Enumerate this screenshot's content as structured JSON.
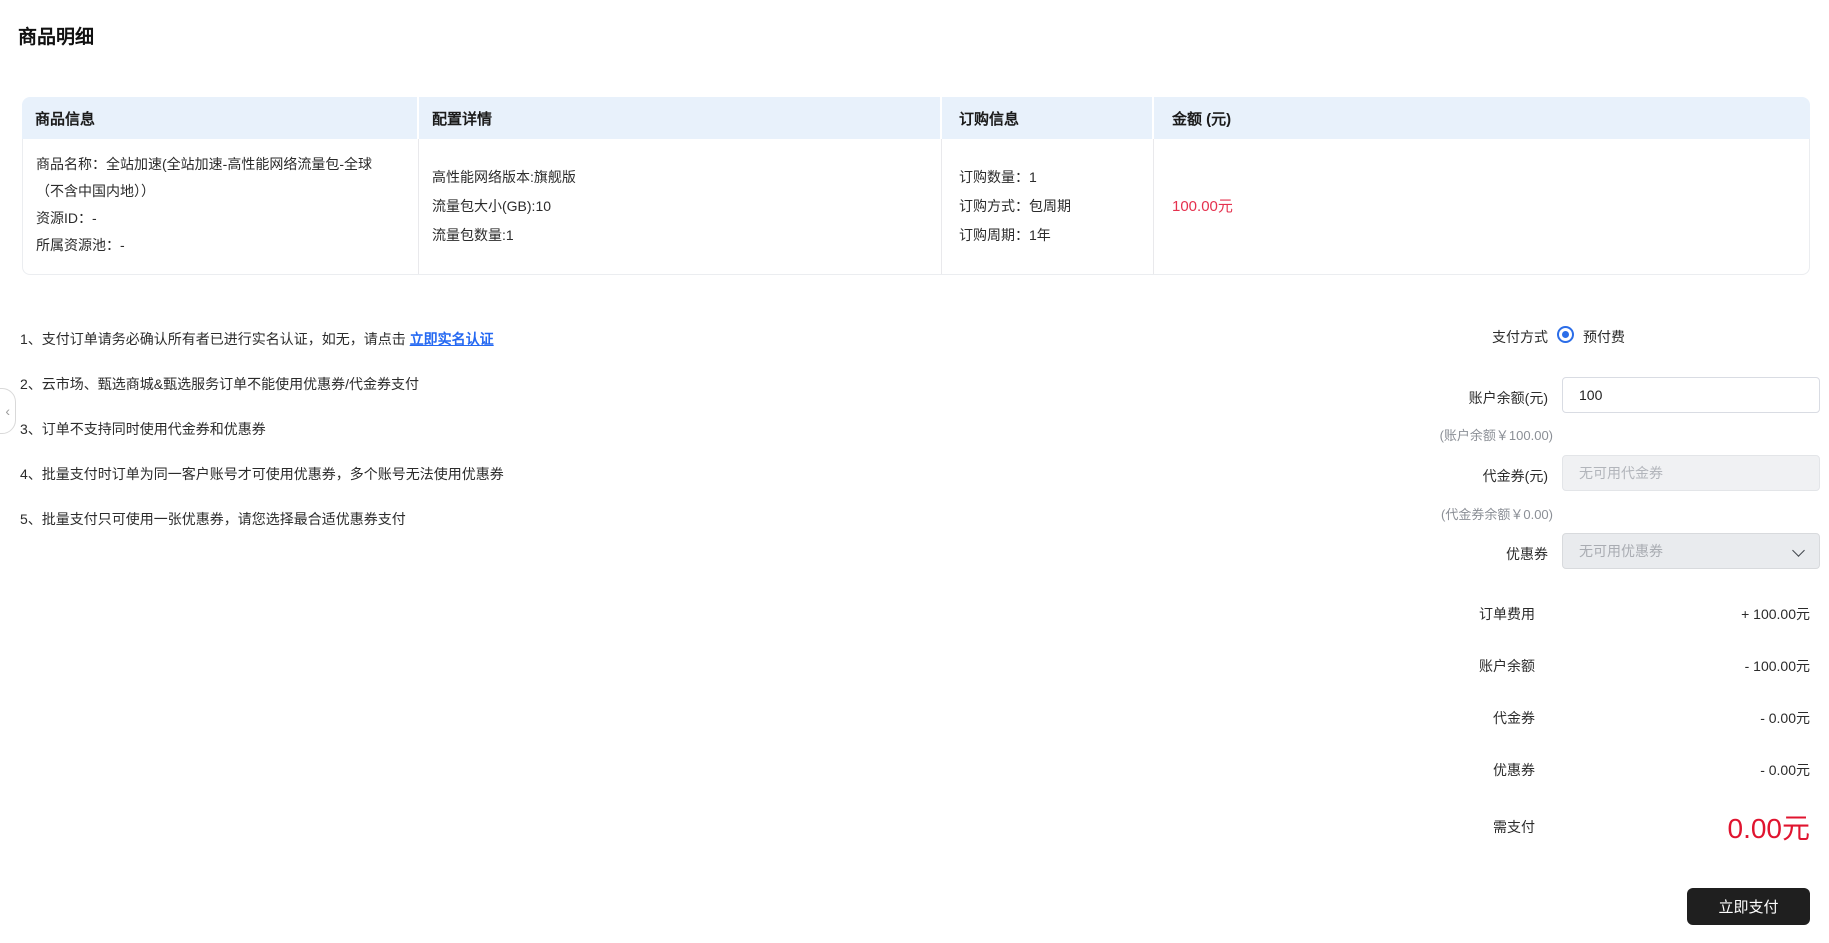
{
  "page": {
    "title": "商品明细"
  },
  "table": {
    "headers": [
      "商品信息",
      "配置详情",
      "订购信息",
      "金额 (元)"
    ],
    "row": {
      "product_lines": [
        "商品名称：全站加速(全站加速-高性能网络流量包-全球",
        "（不含中国内地））",
        "资源ID：-",
        "所属资源池：-"
      ],
      "config_lines": [
        "高性能网络版本:旗舰版",
        "流量包大小(GB):10",
        "流量包数量:1"
      ],
      "order_lines": [
        "订购数量：1",
        "订购方式：包周期",
        "订购周期：1年"
      ],
      "amount": "100.00元"
    }
  },
  "notes": [
    {
      "text": "1、支付订单请务必确认所有者已进行实名认证，如无，请点击 ",
      "link": "立即实名认证"
    },
    {
      "text": "2、云市场、甄选商城&甄选服务订单不能使用优惠券/代金券支付"
    },
    {
      "text": "3、订单不支持同时使用代金券和优惠券"
    },
    {
      "text": "4、批量支付时订单为同一客户账号才可使用优惠券，多个账号无法使用优惠券"
    },
    {
      "text": "5、批量支付只可使用一张优惠券，请您选择最合适优惠券支付"
    }
  ],
  "collapse_handle": {
    "glyph": "‹"
  },
  "form": {
    "payment_method_label": "支付方式",
    "payment_method_option": "预付费",
    "balance_label": "账户余额(元)",
    "balance_value": "100",
    "balance_hint": "(账户余额￥100.00)",
    "voucher_label": "代金券(元)",
    "voucher_placeholder": "无可用代金券",
    "voucher_hint": "(代金券余额￥0.00)",
    "coupon_label": "优惠券",
    "coupon_placeholder": "无可用优惠券"
  },
  "summary": {
    "rows": [
      {
        "label": "订单费用",
        "value": "+ 100.00元"
      },
      {
        "label": "账户余额",
        "value": "- 100.00元"
      },
      {
        "label": "代金券",
        "value": "- 0.00元"
      },
      {
        "label": "优惠券",
        "value": "- 0.00元"
      }
    ],
    "due_label": "需支付",
    "due_value": "0.00元"
  },
  "actions": {
    "pay_button": "立即支付"
  },
  "colors": {
    "header_bg": "#e8f1fb",
    "accent_blue": "#2b6de8",
    "link_blue": "#2468f2",
    "price_red": "#e5314e",
    "due_red": "#e0142f",
    "button_dark": "#1f1f1f"
  }
}
